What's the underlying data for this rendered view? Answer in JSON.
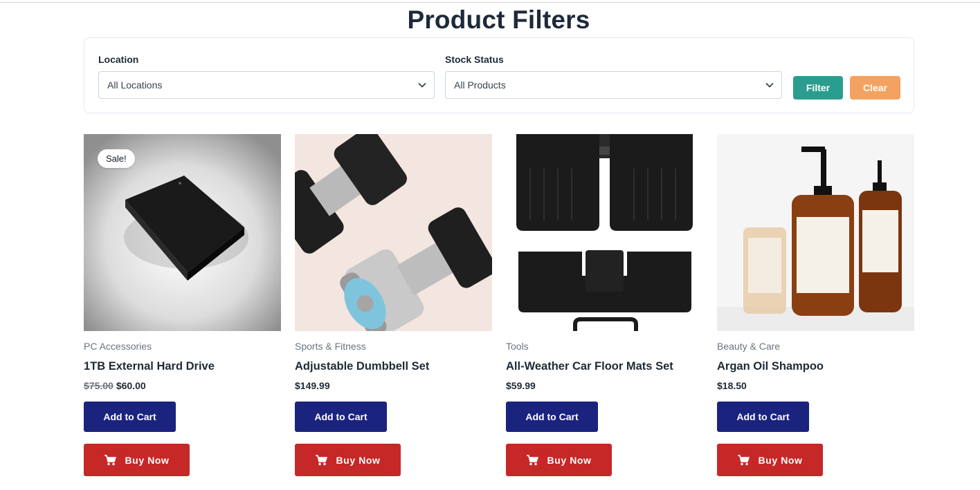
{
  "page": {
    "title": "Product Filters"
  },
  "filters": {
    "location": {
      "label": "Location",
      "value": "All Locations"
    },
    "stock": {
      "label": "Stock Status",
      "value": "All Products"
    },
    "filter_label": "Filter",
    "clear_label": "Clear"
  },
  "products": [
    {
      "category": "PC Accessories",
      "name": "1TB External Hard Drive",
      "old_price": "$75.00",
      "price": "$60.00",
      "badge": "Sale!",
      "add_label": "Add to Cart",
      "buy_label": "Buy Now"
    },
    {
      "category": "Sports & Fitness",
      "name": "Adjustable Dumbbell Set",
      "price": "$149.99",
      "add_label": "Add to Cart",
      "buy_label": "Buy Now"
    },
    {
      "category": "Tools",
      "name": "All-Weather Car Floor Mats Set",
      "price": "$59.99",
      "add_label": "Add to Cart",
      "buy_label": "Buy Now"
    },
    {
      "category": "Beauty & Care",
      "name": "Argan Oil Shampoo",
      "price": "$18.50",
      "add_label": "Add to Cart",
      "buy_label": "Buy Now"
    }
  ],
  "colors": {
    "primary": "#1a237e",
    "danger": "#c62828",
    "filter": "#2a9d8f",
    "clear": "#f4a261"
  }
}
